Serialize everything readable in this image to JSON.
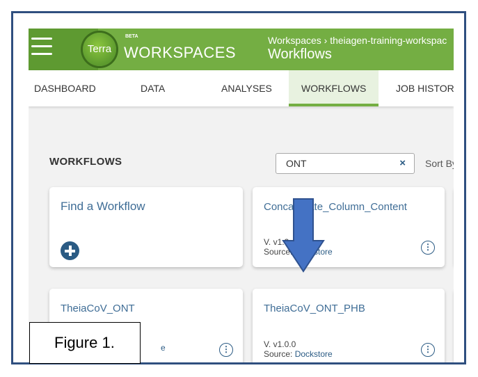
{
  "header": {
    "logo_text": "Terra",
    "beta_badge": "BETA",
    "app_title": "WORKSPACES",
    "breadcrumb": "Workspaces › theiagen-training-workspac",
    "page_title": "Workflows",
    "brand_color": "#74ae43"
  },
  "tabs": [
    {
      "label": "DASHBOARD",
      "active": false
    },
    {
      "label": "DATA",
      "active": false
    },
    {
      "label": "ANALYSES",
      "active": false
    },
    {
      "label": "WORKFLOWS",
      "active": true
    },
    {
      "label": "JOB HISTORY",
      "active": false
    }
  ],
  "workflows": {
    "section_title": "WORKFLOWS",
    "search_value": "ONT",
    "clear_icon": "×",
    "sort_label": "Sort By"
  },
  "cards": {
    "find": {
      "title": "Find a Workflow"
    },
    "concat": {
      "title": "Concatenate_Column_Content",
      "version": "V. v1.3.4",
      "source_prefix": "Source: ",
      "source": "Dockstore"
    },
    "ont": {
      "title": "TheiaCoV_ONT",
      "version": "",
      "source_prefix": "",
      "source": "e"
    },
    "ont_phb": {
      "title": "TheiaCoV_ONT_PHB",
      "version": "V. v1.0.0",
      "source_prefix": "Source: ",
      "source": "Dockstore"
    }
  },
  "annotation": {
    "figure_label": "Figure 1.",
    "arrow_color": "#4472c4",
    "frame_color": "#2f4f7f"
  }
}
